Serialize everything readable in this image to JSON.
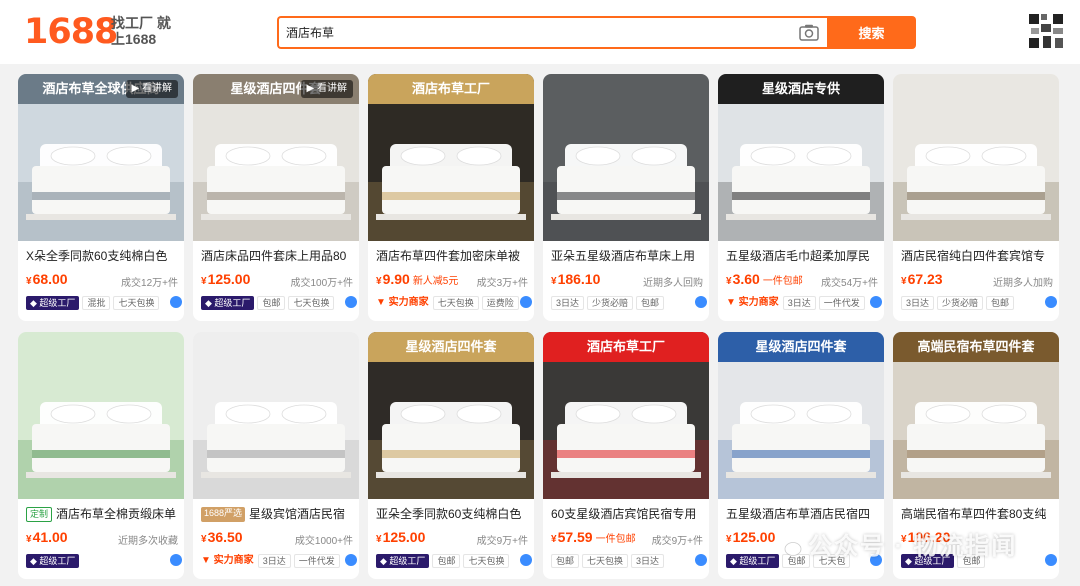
{
  "header": {
    "logo_text": "1688",
    "slogan": "找工厂 就上1688",
    "search_value": "酒店布草",
    "search_button": "搜索"
  },
  "products": [
    {
      "title": "X朵全季同款60支纯棉白色",
      "price": "68.00",
      "promo": "",
      "sold": "成交12万+件",
      "badge": "超级工厂",
      "tags": [
        "混批",
        "七天包换"
      ],
      "banner": "酒店布草全球供应商",
      "play": "看讲解",
      "colors": {
        "bg": "#cfd8df",
        "accent": "#6b7b88"
      }
    },
    {
      "title": "酒店床品四件套床上用品80",
      "price": "125.00",
      "promo": "",
      "sold": "成交100万+件",
      "badge": "超级工厂",
      "tags": [
        "包邮",
        "七天包换"
      ],
      "banner": "星级酒店四件套",
      "play": "看讲解",
      "colors": {
        "bg": "#e6e4df",
        "accent": "#8a7f70"
      }
    },
    {
      "title": "酒店布草四件套加密床单被",
      "price": "9.90",
      "promo": "新人减5元",
      "sold": "成交3万+件",
      "badge": "实力商家",
      "tags": [
        "七天包换",
        "运费险"
      ],
      "banner": "酒店布草工厂",
      "play": "",
      "colors": {
        "bg": "#2e2a24",
        "accent": "#c9a45c"
      }
    },
    {
      "title": "亚朵五星级酒店布草床上用",
      "price": "186.10",
      "promo": "",
      "sold": "近期多人回购",
      "badge": "",
      "tags": [
        "3日达",
        "少货必赔",
        "包邮"
      ],
      "banner": "",
      "play": "",
      "colors": {
        "bg": "#5b5e60",
        "accent": "#2b2d2f"
      }
    },
    {
      "title": "五星级酒店毛巾超柔加厚民",
      "price": "3.60",
      "promo": "一件包邮",
      "sold": "成交54万+件",
      "badge": "实力商家",
      "tags": [
        "3日达",
        "一件代发"
      ],
      "banner": "星级酒店专供",
      "play": "",
      "colors": {
        "bg": "#dfe3e6",
        "accent": "#1f1f1f"
      }
    },
    {
      "title": "酒店民宿纯白四件套宾馆专",
      "price": "67.23",
      "promo": "",
      "sold": "近期多人加购",
      "badge": "",
      "tags": [
        "3日达",
        "少货必赔",
        "包邮"
      ],
      "banner": "",
      "play": "",
      "colors": {
        "bg": "#e9e7e2",
        "accent": "#6c5a3d"
      }
    },
    {
      "title": "酒店布草全棉贡缎床单",
      "price": "41.00",
      "promo": "",
      "sold": "近期多次收藏",
      "badge": "超级工厂",
      "tags": [],
      "banner": "",
      "play": "",
      "inline_tag": "定制",
      "colors": {
        "bg": "#d7ead2",
        "accent": "#3d8a3a"
      }
    },
    {
      "title": "星级宾馆酒店民宿",
      "price": "36.50",
      "promo": "",
      "sold": "成交1000+件",
      "badge": "实力商家",
      "tags": [
        "3日达",
        "一件代发"
      ],
      "banner": "",
      "play": "",
      "inline_tag": "1688严选",
      "colors": {
        "bg": "#eeeeee",
        "accent": "#9a9a9a"
      }
    },
    {
      "title": "亚朵全季同款60支纯棉白色",
      "price": "125.00",
      "promo": "",
      "sold": "成交9万+件",
      "badge": "超级工厂",
      "tags": [
        "包邮",
        "七天包换"
      ],
      "banner": "星级酒店四件套",
      "play": "",
      "colors": {
        "bg": "#2f2b27",
        "accent": "#c9a45c"
      }
    },
    {
      "title": "60支星级酒店宾馆民宿专用",
      "price": "57.59",
      "promo": "一件包邮",
      "sold": "成交9万+件",
      "badge": "",
      "tags": [
        "包邮",
        "七天包换",
        "3日达"
      ],
      "banner": "酒店布草工厂",
      "play": "",
      "colors": {
        "bg": "#3a3937",
        "accent": "#e02020"
      }
    },
    {
      "title": "五星级酒店布草酒店民宿四",
      "price": "125.00",
      "promo": "",
      "sold": "",
      "badge": "超级工厂",
      "tags": [
        "包邮",
        "七天包"
      ],
      "banner": "星级酒店四件套",
      "play": "",
      "colors": {
        "bg": "#e4e6e9",
        "accent": "#2d5fa8"
      }
    },
    {
      "title": "高端民宿布草四件套80支纯",
      "price": "106.20",
      "promo": "",
      "sold": "",
      "badge": "超级工厂",
      "tags": [
        "包邮"
      ],
      "banner": "高端民宿布草四件套",
      "play": "",
      "colors": {
        "bg": "#d9d3c8",
        "accent": "#7a5a2e"
      }
    }
  ],
  "watermark": "公众号 · 物流指闻",
  "colors": {
    "brand": "#ff6a1a",
    "price": "#ff4000",
    "badge_super": "#2b1a6b"
  }
}
